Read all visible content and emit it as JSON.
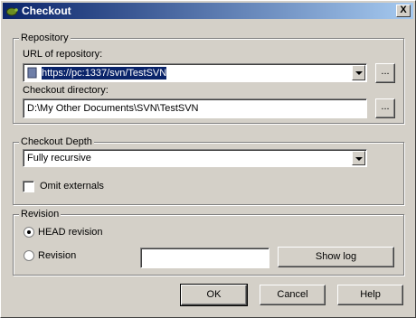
{
  "window": {
    "title": "Checkout",
    "close_glyph": "X"
  },
  "repository": {
    "legend": "Repository",
    "url_label": "URL of repository:",
    "url_value": "https://pc:1337/svn/TestSVN",
    "dir_label": "Checkout directory:",
    "dir_value": "D:\\My Other Documents\\SVN\\TestSVN",
    "browse_label": "..."
  },
  "depth": {
    "legend": "Checkout Depth",
    "selected": "Fully recursive",
    "omit_label": "Omit externals",
    "omit_checked": false
  },
  "revision": {
    "legend": "Revision",
    "head_label": "HEAD revision",
    "rev_label": "Revision",
    "rev_value": "",
    "show_log_label": "Show log",
    "selected": "head"
  },
  "buttons": {
    "ok": "OK",
    "cancel": "Cancel",
    "help": "Help"
  },
  "icons": {
    "app": "tortoise-icon",
    "dropdown": "chevron-down-icon"
  }
}
